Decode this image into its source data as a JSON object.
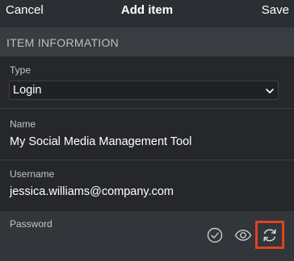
{
  "navbar": {
    "cancel_label": "Cancel",
    "title": "Add item",
    "save_label": "Save"
  },
  "section": {
    "title": "ITEM INFORMATION"
  },
  "fields": {
    "type": {
      "label": "Type",
      "selected": "Login"
    },
    "name": {
      "label": "Name",
      "value": "My Social Media Management Tool"
    },
    "username": {
      "label": "Username",
      "value": "jessica.williams@company.com"
    },
    "password": {
      "label": "Password",
      "value": ""
    }
  },
  "icons": {
    "check": "check-circle-icon",
    "eye": "eye-icon",
    "regenerate": "refresh-icon"
  },
  "colors": {
    "highlight": "#e0421f",
    "background": "#2a2d31"
  }
}
